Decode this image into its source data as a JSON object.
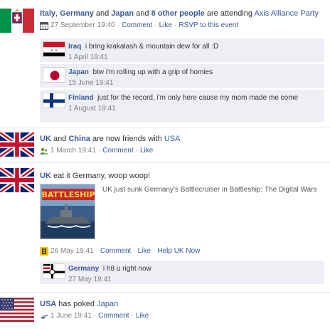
{
  "stories": {
    "party": {
      "actors": [
        "Italy",
        "Germany",
        "Japan"
      ],
      "sep_comma": ", ",
      "sep_and1": " and ",
      "sep_and2": " and ",
      "others": "8 other people",
      "verb": " are attending ",
      "event": "Axis Alliance Party",
      "date": "27 September 19:40",
      "actions": [
        "Comment",
        "Like",
        "RSVP to this event"
      ],
      "comments": [
        {
          "author": "Iraq",
          "text": "i bring krakalash & mountain dew for all :D",
          "time": "1 April 19:41"
        },
        {
          "author": "Japan",
          "text": "btw i'm rolling up with a grip of homies",
          "time": "15 June 19:41"
        },
        {
          "author": "Finland",
          "text": "just for the record, i'm only here cause my mom made me come",
          "time": "1 August 19:41"
        }
      ]
    },
    "friends": {
      "a": "UK",
      "b": "China",
      "and": " and ",
      "verb": " are now friends with ",
      "c": "USA",
      "date": "1 March 19:41",
      "actions": [
        "Comment",
        "Like"
      ]
    },
    "battleship": {
      "actor": "UK",
      "status": " eat it Germany, woop woop!",
      "game_title": "BATTLESHIP",
      "attachment_text": "UK just sunk Germany's Battlecruiser in Battleship: The Digital Wars",
      "date": "26 May 19:41",
      "actions": [
        "Comment",
        "Like",
        "Help UK Now"
      ],
      "comment": {
        "author": "Germany",
        "text": "i h8 u right now",
        "time": "27 May 19:41"
      }
    },
    "poke": {
      "actor": "USA",
      "verb": " has poked ",
      "target": "Japan",
      "date": "1 June 19:41",
      "actions": [
        "Comment",
        "Like"
      ]
    }
  },
  "colors": {
    "link": "#3b5998",
    "comment_bg": "#edeff4",
    "meta": "#808080"
  }
}
